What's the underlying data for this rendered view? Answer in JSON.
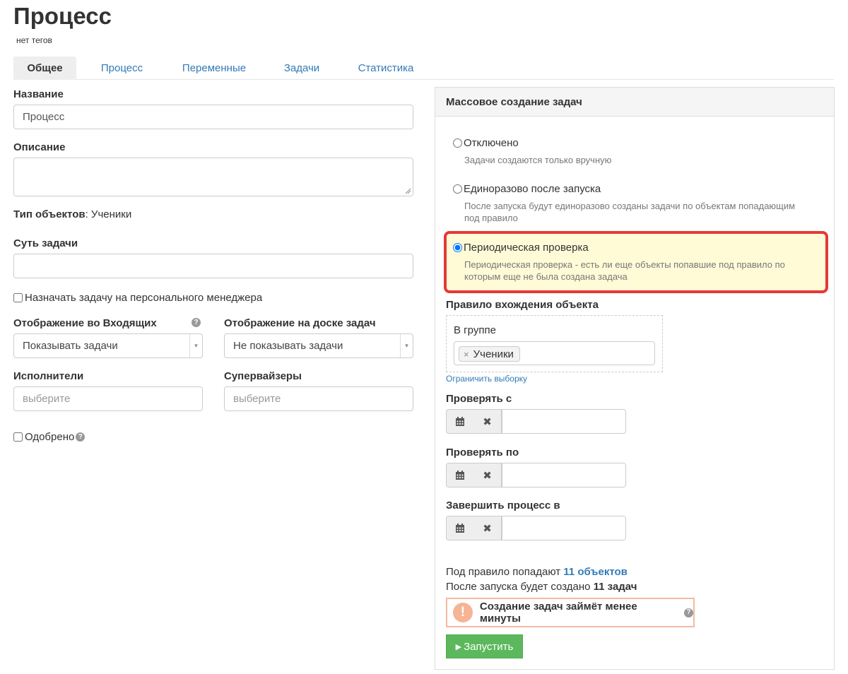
{
  "header": {
    "title": "Процесс",
    "tags": "нет тегов"
  },
  "tabs": [
    {
      "label": "Общее",
      "active": true
    },
    {
      "label": "Процесс",
      "active": false
    },
    {
      "label": "Переменные",
      "active": false
    },
    {
      "label": "Задачи",
      "active": false
    },
    {
      "label": "Статистика",
      "active": false
    }
  ],
  "form": {
    "name_label": "Название",
    "name_value": "Процесс",
    "description_label": "Описание",
    "description_value": "",
    "object_type_label": "Тип объектов",
    "object_type_value": ": Ученики",
    "task_essence_label": "Суть задачи",
    "task_essence_value": "",
    "assign_manager_label": "Назначать задачу на персонального менеджера",
    "assign_manager_checked": false,
    "inbox_label": "Отображение во Входящих",
    "inbox_value": "Показывать задачи",
    "board_label": "Отображение на доске задач",
    "board_value": "Не показывать задачи",
    "executors_label": "Исполнители",
    "executors_placeholder": "выберите",
    "supervisors_label": "Супервайзеры",
    "supervisors_placeholder": "выберите",
    "approved_label": "Одобрено",
    "approved_checked": false
  },
  "mass_creation": {
    "title": "Массовое создание задач",
    "options": [
      {
        "label": "Отключено",
        "description": "Задачи создаются только вручную",
        "selected": false
      },
      {
        "label": "Единоразово после запуска",
        "description": "После запуска будут единоразово созданы задачи по объектам попадающим под правило",
        "selected": false
      },
      {
        "label": "Периодическая проверка",
        "description": "Периодическая проверка - есть ли еще объекты попавшие под правило по которым еще не была создана задача",
        "selected": true
      }
    ],
    "rule_label": "Правило вхождения объекта",
    "group_label": "В группе",
    "group_tag": "Ученики",
    "limit_link": "Ограничить выборку",
    "check_from_label": "Проверять с",
    "check_to_label": "Проверять по",
    "finish_label": "Завершить процесс в",
    "summary_line1_prefix": "Под правило попадают",
    "summary_objects": "11 объектов",
    "summary_line2_prefix": "После запуска будет создано",
    "summary_tasks": "11 задач",
    "warning_icon": "!",
    "warning_text": "Создание задач займёт менее минуты",
    "run_label": "Запустить"
  },
  "icons": {
    "help": "?",
    "remove_tag": "×",
    "calendar": "calendar-icon",
    "clear": "✖",
    "dropdown_arrow": "▾",
    "play": "▶"
  },
  "colors": {
    "link": "#337ab7",
    "highlight_border": "#e53935",
    "highlight_bg": "#fffbd7",
    "run_button": "#5cb85c",
    "warning_border": "#f4b9a0"
  }
}
